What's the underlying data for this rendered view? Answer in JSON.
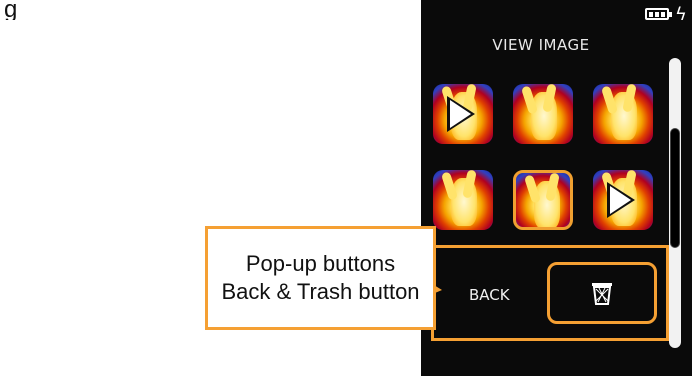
{
  "heading_partial": "g",
  "device": {
    "title": "VIEW IMAGE",
    "status_icons": [
      "battery-icon",
      "charging-bolt-icon"
    ],
    "thumbnails": [
      {
        "row": 1,
        "col": 1,
        "has_play": true,
        "selected": false
      },
      {
        "row": 1,
        "col": 2,
        "has_play": false,
        "selected": false
      },
      {
        "row": 1,
        "col": 3,
        "has_play": false,
        "selected": false
      },
      {
        "row": 2,
        "col": 1,
        "has_play": false,
        "selected": false
      },
      {
        "row": 2,
        "col": 2,
        "has_play": false,
        "selected": true
      },
      {
        "row": 2,
        "col": 3,
        "has_play": true,
        "selected": false
      }
    ],
    "back_label": "BACK",
    "trash_icon": "trash-icon"
  },
  "callout": {
    "line1": "Pop-up buttons",
    "line2": "Back & Trash button"
  },
  "colors": {
    "accent": "#f5a033",
    "screen_bg": "#0a0a0a"
  }
}
